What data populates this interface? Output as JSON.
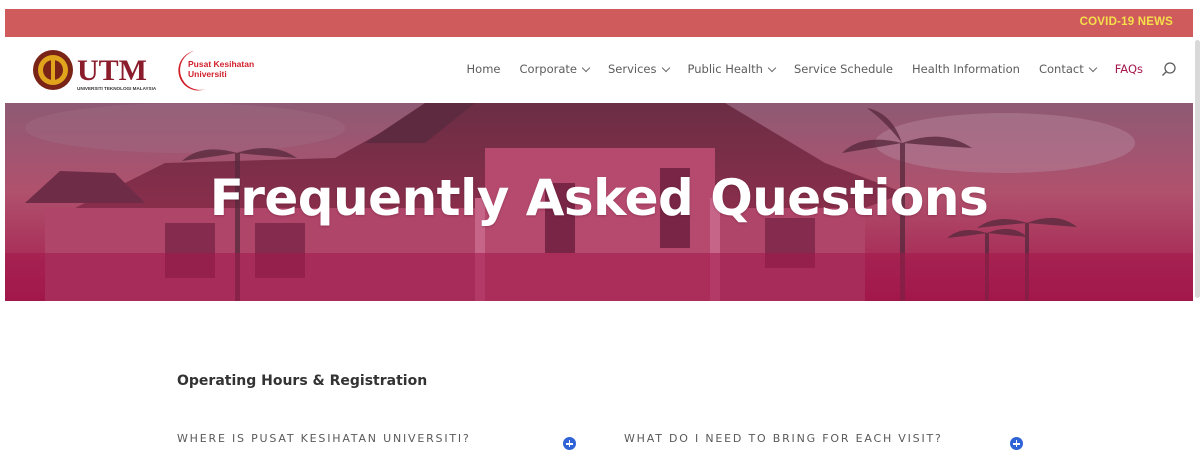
{
  "topbar": {
    "link_label": "COVID-19 NEWS"
  },
  "brand": {
    "utm": "UTM",
    "utm_sub": "UNIVERSITI TEKNOLOGI MALAYSIA",
    "pusat_line1": "Pusat Kesihatan",
    "pusat_line2": "Universiti"
  },
  "nav": {
    "items": [
      {
        "label": "Home"
      },
      {
        "label": "Corporate"
      },
      {
        "label": "Services"
      },
      {
        "label": "Public Health"
      },
      {
        "label": "Service Schedule"
      },
      {
        "label": "Health Information"
      },
      {
        "label": "Contact"
      },
      {
        "label": "FAQs"
      }
    ]
  },
  "hero": {
    "title": "Frequently Asked Questions"
  },
  "section": {
    "title": "Operating Hours & Registration",
    "questions": [
      {
        "text": "WHERE IS PUSAT KESIHATAN UNIVERSITI?"
      },
      {
        "text": "WHAT DO I NEED TO BRING FOR EACH VISIT?"
      }
    ]
  },
  "colors": {
    "topbar": "#cf5b5d",
    "topbar_link": "#f5e04a",
    "hero_overlay": "#a3174b",
    "nav_active": "#a3174b",
    "accordion_icon": "#2f63d6"
  }
}
